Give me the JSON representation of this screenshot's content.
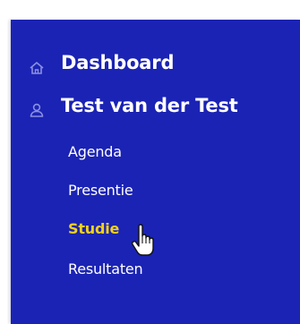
{
  "sidebar": {
    "main_items": [
      {
        "label": "Dashboard",
        "icon": "home-icon"
      },
      {
        "label": "Test van der Test",
        "icon": "user-icon"
      }
    ],
    "sub_items": [
      {
        "label": "Agenda",
        "active": false
      },
      {
        "label": "Presentie",
        "active": false
      },
      {
        "label": "Studie",
        "active": true
      },
      {
        "label": "Resultaten",
        "active": false
      }
    ]
  },
  "colors": {
    "sidebar_bg": "#1b23b4",
    "text": "#ffffff",
    "active": "#f2d11c",
    "icon": "#8a90e0"
  }
}
